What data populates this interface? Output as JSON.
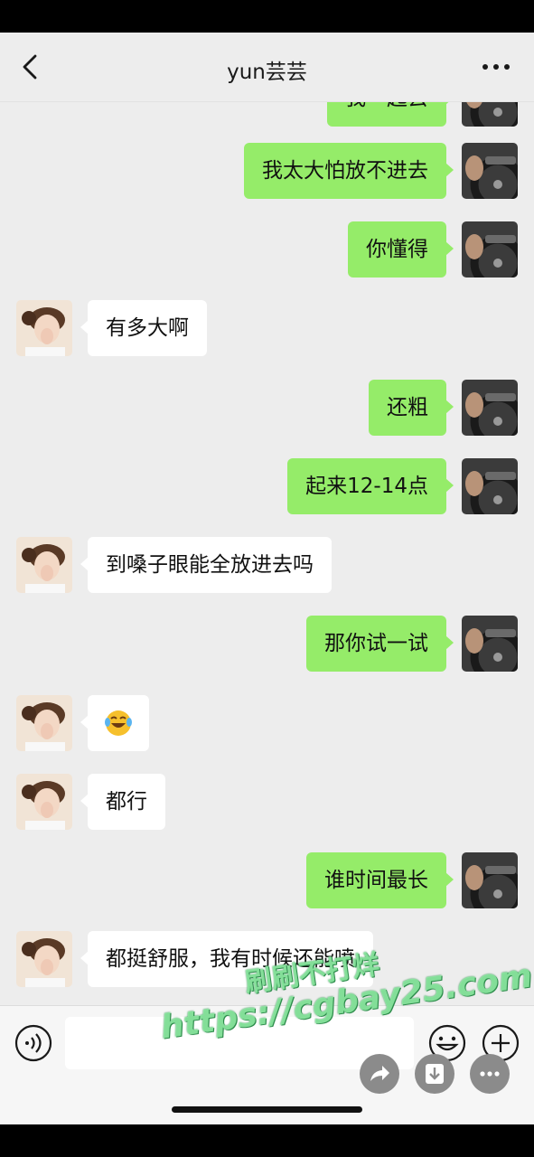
{
  "header": {
    "title": "yun芸芸",
    "back_icon": "chevron-left-icon",
    "more_icon": "more-icon"
  },
  "colors": {
    "background": "#ededed",
    "my_bubble": "#95ec69",
    "her_bubble": "#ffffff"
  },
  "messages": [
    {
      "from": "me",
      "text": "我一起去",
      "partial": true
    },
    {
      "from": "me",
      "text": "我太大怕放不进去"
    },
    {
      "from": "me",
      "text": "你懂得"
    },
    {
      "from": "her",
      "text": "有多大啊"
    },
    {
      "from": "me",
      "text": "还粗"
    },
    {
      "from": "me",
      "text": "起来12-14点"
    },
    {
      "from": "her",
      "text": "到嗓子眼能全放进去吗"
    },
    {
      "from": "me",
      "text": "那你试一试"
    },
    {
      "from": "her",
      "text": "😂"
    },
    {
      "from": "her",
      "text": "都行"
    },
    {
      "from": "me",
      "text": "谁时间最长"
    },
    {
      "from": "her",
      "text": "都挺舒服，我有时候还能喷"
    }
  ],
  "input": {
    "value": "",
    "voice_icon": "voice-icon",
    "emoji_icon": "emoji-icon",
    "plus_icon": "plus-icon"
  },
  "floating_actions": [
    "share-icon",
    "download-icon",
    "more-icon"
  ],
  "watermark": {
    "line1": "刷刷不打烊",
    "line2": "https://cgbay25.com"
  }
}
